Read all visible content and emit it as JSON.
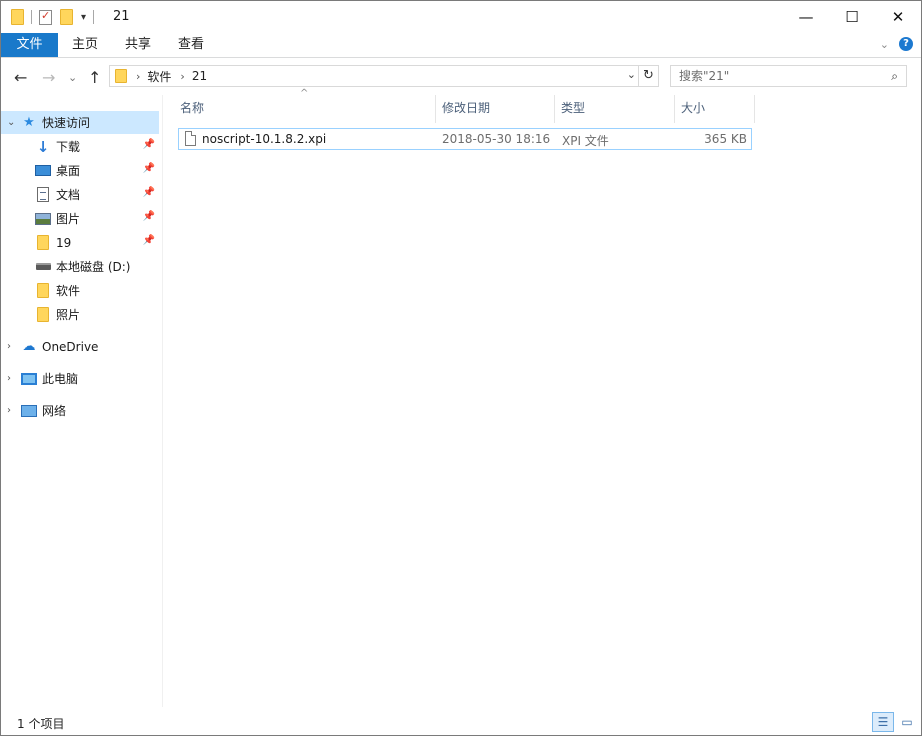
{
  "window": {
    "title": "21",
    "caption": {
      "minimize": "—",
      "maximize": "☐",
      "close": "✕"
    }
  },
  "quick_access_toolbar": {
    "icons": [
      "folder-icon",
      "properties-icon",
      "new-folder-icon",
      "customize-dropdown-icon"
    ]
  },
  "ribbon": {
    "tabs": [
      {
        "label": "文件",
        "active": true
      },
      {
        "label": "主页"
      },
      {
        "label": "共享"
      },
      {
        "label": "查看"
      }
    ],
    "collapse_icon": "⌄",
    "help_icon": "?"
  },
  "navigation": {
    "back": "←",
    "forward": "→",
    "recent": "⌄",
    "up": "↑"
  },
  "address_bar": {
    "path": [
      "软件",
      "21"
    ],
    "separator": "›"
  },
  "search": {
    "placeholder": "搜索\"21\""
  },
  "nav_pane": {
    "quick_access": "快速访问",
    "items": [
      {
        "label": "下载",
        "icon": "download-icon",
        "pinned": true
      },
      {
        "label": "桌面",
        "icon": "desktop-icon",
        "pinned": true
      },
      {
        "label": "文档",
        "icon": "documents-icon",
        "pinned": true
      },
      {
        "label": "图片",
        "icon": "pictures-icon",
        "pinned": true
      },
      {
        "label": "19",
        "icon": "folder-icon",
        "pinned": true
      },
      {
        "label": "本地磁盘 (D:)",
        "icon": "drive-icon",
        "pinned": false
      },
      {
        "label": "软件",
        "icon": "folder-icon",
        "pinned": false
      },
      {
        "label": "照片",
        "icon": "folder-icon",
        "pinned": false
      }
    ],
    "roots": [
      {
        "label": "OneDrive",
        "icon": "onedrive-icon"
      },
      {
        "label": "此电脑",
        "icon": "this-pc-icon"
      },
      {
        "label": "网络",
        "icon": "network-icon"
      }
    ]
  },
  "file_list": {
    "columns": [
      "名称",
      "修改日期",
      "类型",
      "大小"
    ],
    "rows": [
      {
        "name": "noscript-10.1.8.2.xpi",
        "modified": "2018-05-30 18:16",
        "type": "XPI 文件",
        "size": "365 KB"
      }
    ]
  },
  "status_bar": {
    "item_count": "1 个项目"
  },
  "colors": {
    "accent": "#1979ca",
    "selection": "#cce8ff",
    "header_text": "#4c607a"
  }
}
